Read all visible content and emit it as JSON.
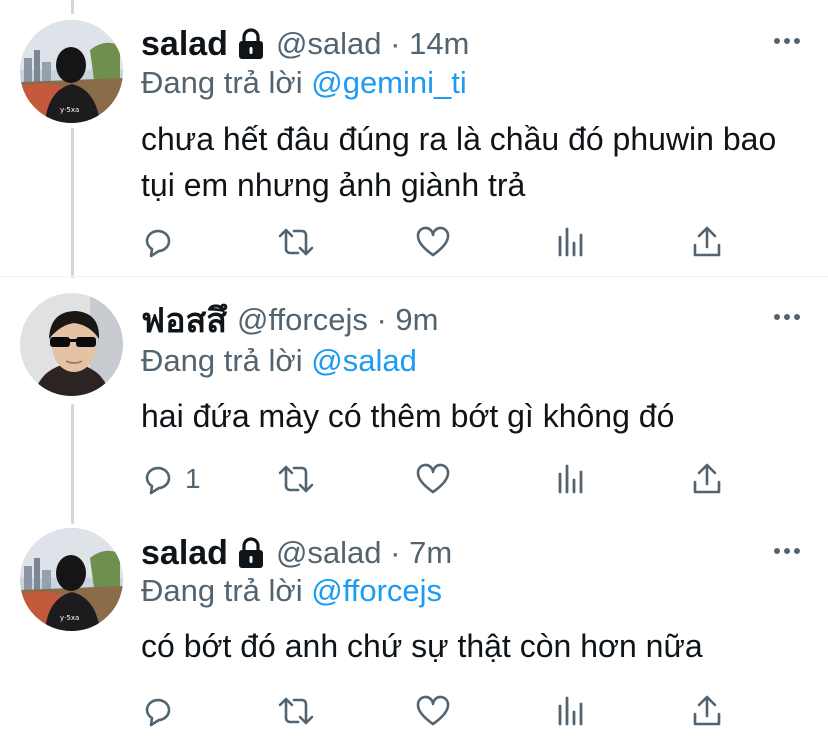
{
  "tweets": [
    {
      "name": "salad",
      "handle": "@salad · 14m",
      "reply_prefix": "Đang trả lời ",
      "reply_to": "@gemini_ti",
      "text": "chưa hết đâu đúng ra là chầu đó phuwin bao tụi em nhưng ảnh giành trả",
      "reply_count": ""
    },
    {
      "name": "ฟอสสึ",
      "handle": "@fforcejs · 9m",
      "reply_prefix": "Đang trả lời ",
      "reply_to": "@salad",
      "text": "hai đứa mày có thêm bớt gì không đó",
      "reply_count": "1"
    },
    {
      "name": "salad",
      "handle": "@salad · 7m",
      "reply_prefix": "Đang trả lời ",
      "reply_to": "@fforcejs",
      "text": "có bớt đó anh chứ sự thật còn hơn nữa",
      "reply_count": ""
    }
  ],
  "icons": [
    "lock-icon",
    "more-icon",
    "reply-icon",
    "retweet-icon",
    "like-icon",
    "analytics-icon",
    "share-icon"
  ],
  "colors": {
    "text": "#0f1419",
    "muted": "#536471",
    "accent": "#1d9bf0",
    "thread_line": "#cfd9de"
  }
}
